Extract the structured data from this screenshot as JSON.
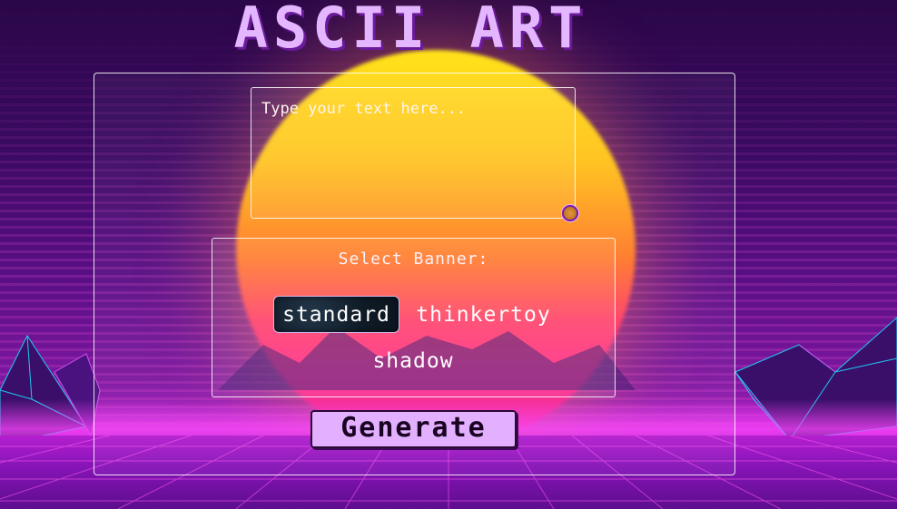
{
  "title": "ASCII ART",
  "input": {
    "placeholder": "Type your text here..."
  },
  "banner": {
    "label": "Select Banner:",
    "options": [
      "standard",
      "thinkertoy",
      "shadow"
    ],
    "selected": "standard"
  },
  "generate_label": "Generate",
  "colors": {
    "title": "#e4b6ff",
    "button_bg": "#e2b0ff",
    "sun_top": "#ffe21a",
    "sun_bottom": "#e51f9c",
    "grid": "#ff5cf0"
  }
}
